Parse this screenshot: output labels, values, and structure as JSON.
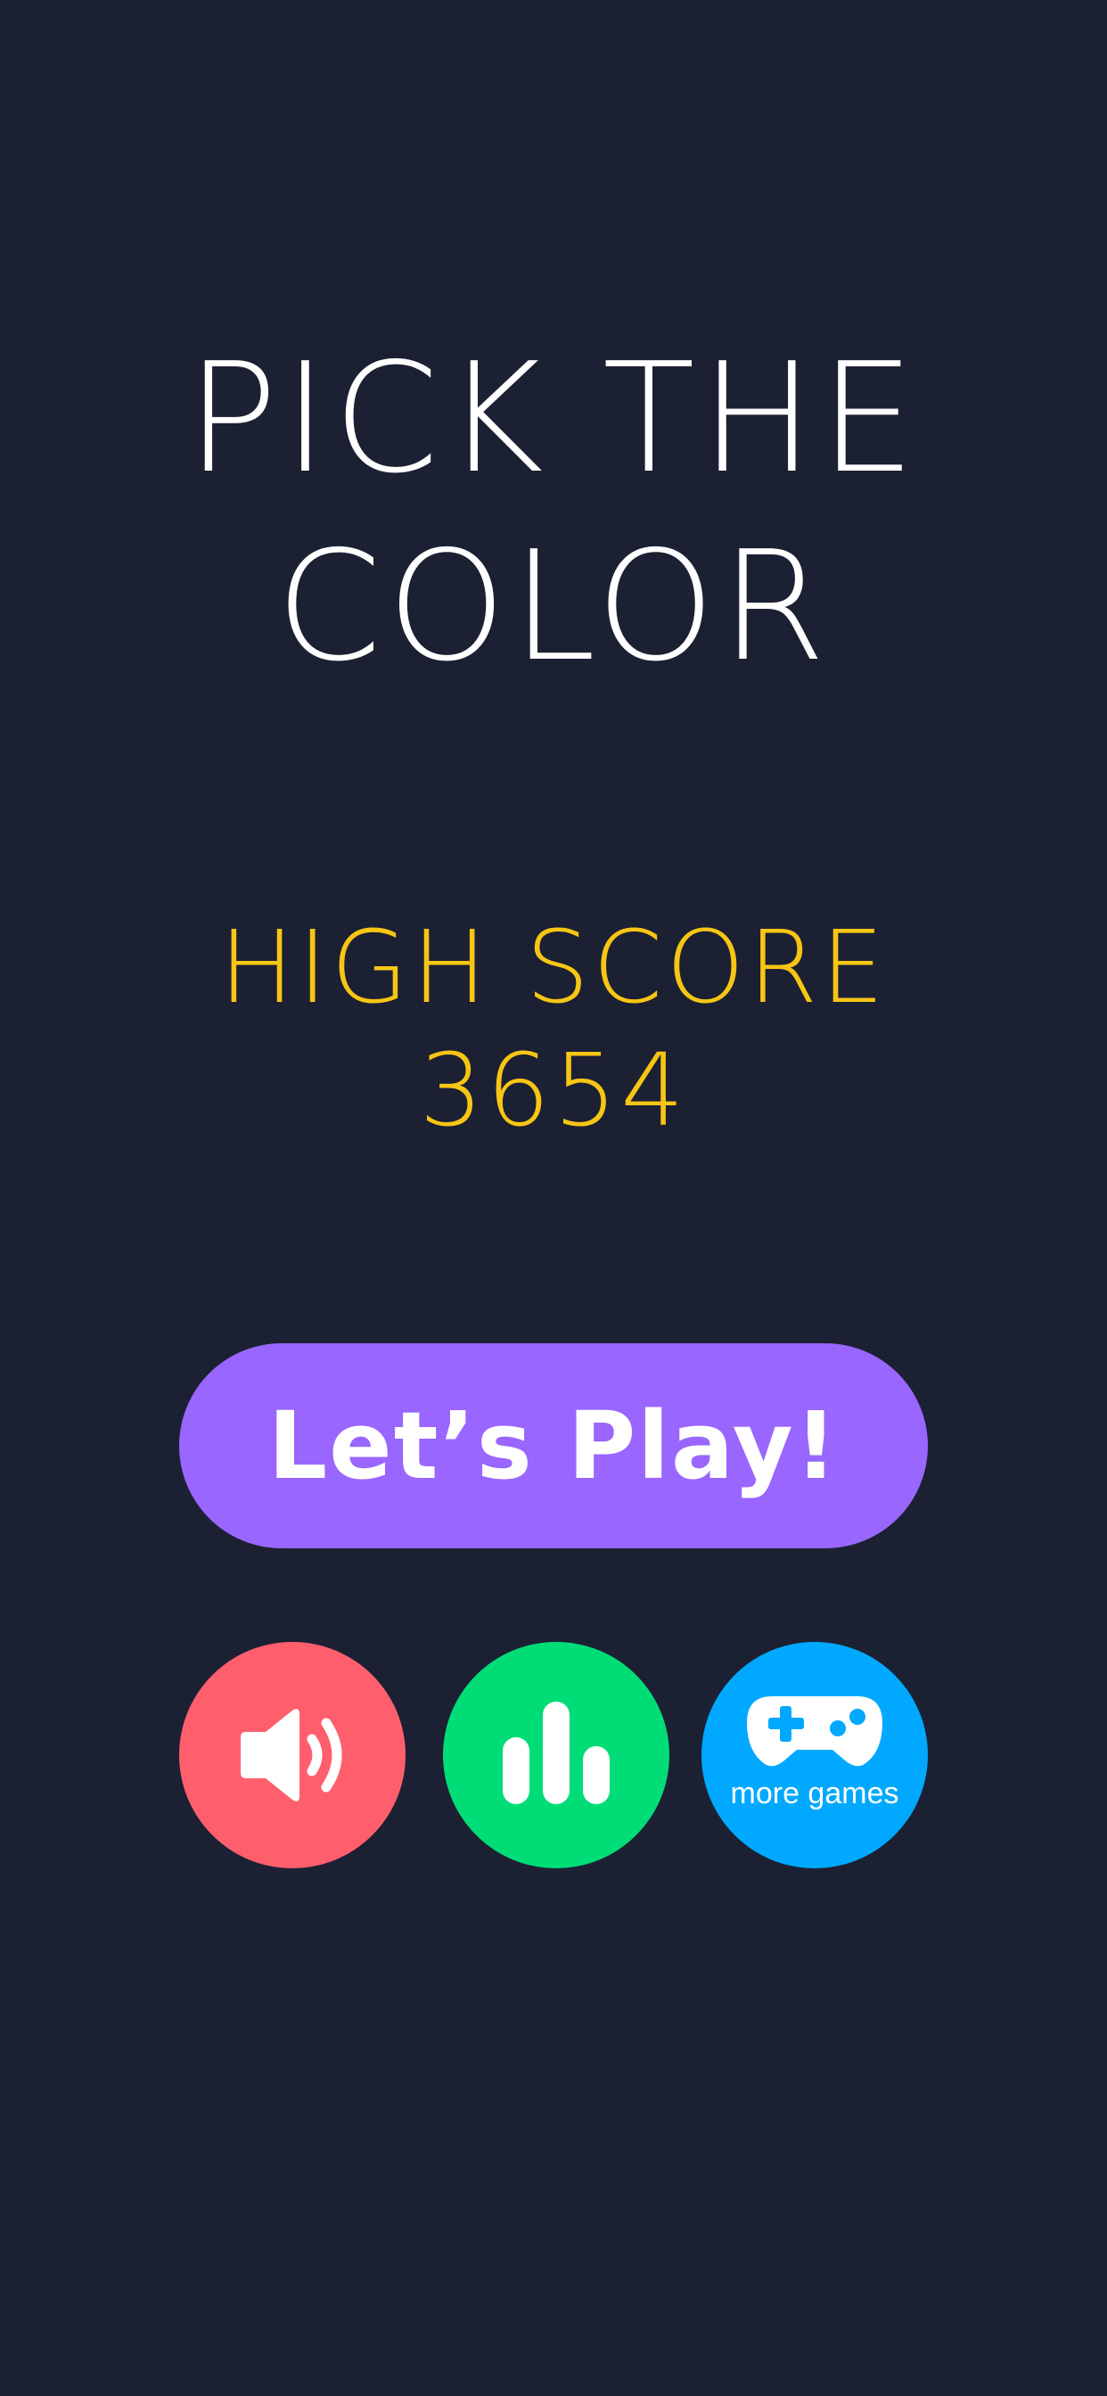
{
  "title": {
    "line1": "PICK THE",
    "line2": "COLOR"
  },
  "high_score": {
    "label": "HIGH SCORE",
    "value": "3654"
  },
  "play_button": {
    "label": "Let’s Play!"
  },
  "round_buttons": {
    "sound": {
      "icon": "speaker-icon"
    },
    "leaderboard": {
      "icon": "bar-chart-icon"
    },
    "more_games": {
      "icon": "gamepad-icon",
      "label": "more games"
    }
  },
  "colors": {
    "background": "#1c2033",
    "title": "#ffffff",
    "high_score": "#f7c614",
    "play_button": "#9966ff",
    "sound_button": "#ff5f6d",
    "leaderboard_button": "#00dd77",
    "more_games_button": "#00a8ff"
  }
}
